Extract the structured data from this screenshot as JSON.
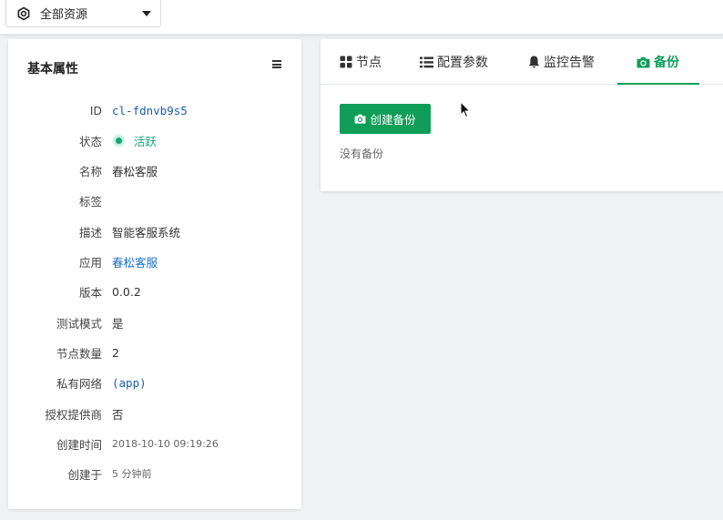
{
  "topbar": {
    "resource_select": {
      "label": "全部资源",
      "icon": "hexagon-gear-icon"
    }
  },
  "left_panel": {
    "title": "基本属性",
    "menu_icon": "hamburger-menu-icon",
    "properties": [
      {
        "key": "ID",
        "value": "cl-fdnvb9s5"
      },
      {
        "key": "状态",
        "value": "活跃"
      },
      {
        "key": "名称",
        "value": "春松客服"
      },
      {
        "key": "标签",
        "value": ""
      },
      {
        "key": "描述",
        "value": "智能客服系统"
      },
      {
        "key": "应用",
        "value": "春松客服"
      },
      {
        "key": "版本",
        "value": "0.0.2"
      },
      {
        "key": "测试模式",
        "value": "是"
      },
      {
        "key": "节点数量",
        "value": "2"
      },
      {
        "key": "私有网络",
        "value": "(app)"
      },
      {
        "key": "授权提供商",
        "value": "否"
      },
      {
        "key": "创建时间",
        "value": "2018-10-10 09:19:26"
      },
      {
        "key": "创建于",
        "value": "5 分钟前"
      }
    ]
  },
  "right_panel": {
    "tabs": [
      {
        "label": "节点",
        "icon": "grid-icon"
      },
      {
        "label": "配置参数",
        "icon": "list-icon"
      },
      {
        "label": "监控告警",
        "icon": "bell-icon"
      },
      {
        "label": "备份",
        "icon": "camera-icon",
        "active": true
      }
    ],
    "create_button": {
      "label": "创建备份",
      "icon": "camera-icon"
    },
    "empty_text": "没有备份"
  },
  "colors": {
    "accent": "#0f9d58",
    "status_active": "#15a675",
    "link": "#1a6fc9",
    "background": "#f0f2f4"
  }
}
